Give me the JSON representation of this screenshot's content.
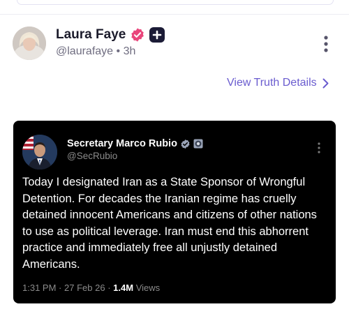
{
  "post": {
    "author_name": "Laura Faye",
    "handle": "@laurafaye",
    "separator": "•",
    "time": "3h",
    "view_details_label": "View Truth Details",
    "icons": {
      "verified": "verified-badge-icon",
      "plus": "plus-badge-icon",
      "more": "more-vertical-icon",
      "chevron": "chevron-right-icon"
    }
  },
  "embedded_post": {
    "author_name": "Secretary Marco Rubio",
    "handle": "@SecRubio",
    "text": "Today I designated Iran as a State Sponsor of Wrongful Detention. For decades the Iranian regime has cruelly detained innocent Americans and citizens of other nations to use as political leverage. Iran must end this abhorrent practice and immediately free all unjustly detained Americans.",
    "time": "1:31 PM",
    "meta_separator": "·",
    "date": "27 Feb 26",
    "views_count": "1.4M",
    "views_label": "Views"
  },
  "colors": {
    "accent": "#6a5ccf",
    "verified_badge": "#e9457b",
    "card_background": "#000000"
  }
}
